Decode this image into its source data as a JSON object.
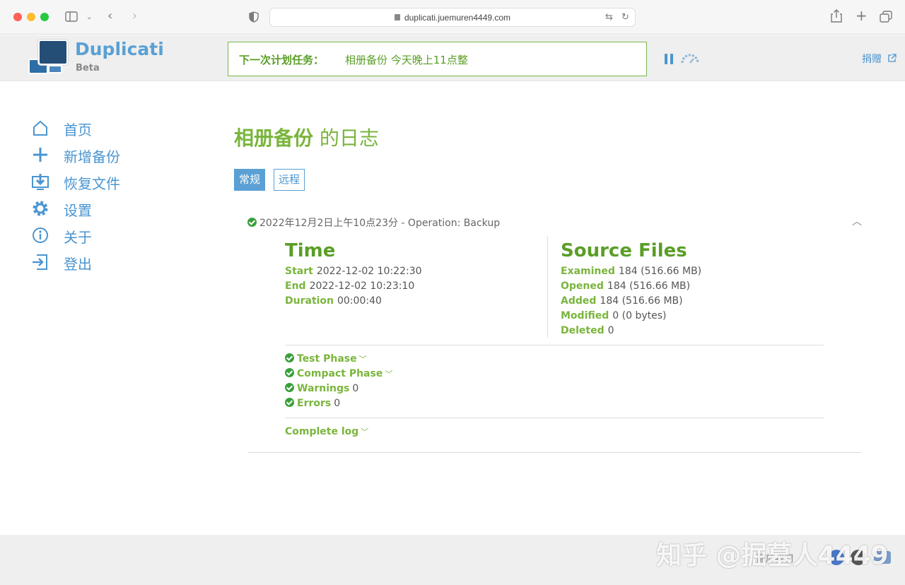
{
  "browser": {
    "url": "duplicati.juemuren4449.com"
  },
  "app": {
    "brand": "Duplicati",
    "beta": "Beta",
    "schedule_label": "下一次计划任务：",
    "schedule_value": "相册备份 今天晚上11点整",
    "donate": "捐赠"
  },
  "nav": {
    "items": [
      {
        "label": "首页",
        "icon": "home-icon"
      },
      {
        "label": "新增备份",
        "icon": "plus-icon"
      },
      {
        "label": "恢复文件",
        "icon": "restore-icon"
      },
      {
        "label": "设置",
        "icon": "gear-icon"
      },
      {
        "label": "关于",
        "icon": "info-icon"
      },
      {
        "label": "登出",
        "icon": "logout-icon"
      }
    ]
  },
  "page": {
    "title_bold": "相册备份",
    "title_rest": " 的日志",
    "tabs": [
      "常规",
      "远程"
    ]
  },
  "log": {
    "header": "2022年12月2日上午10点23分 - Operation: Backup",
    "time": {
      "title": "Time",
      "rows": [
        {
          "k": "Start",
          "v": "2022-12-02 10:22:30"
        },
        {
          "k": "End",
          "v": "2022-12-02 10:23:10"
        },
        {
          "k": "Duration",
          "v": "00:00:40"
        }
      ]
    },
    "source": {
      "title": "Source Files",
      "rows": [
        {
          "k": "Examined",
          "v": "184 (516.66 MB)"
        },
        {
          "k": "Opened",
          "v": "184 (516.66 MB)"
        },
        {
          "k": "Added",
          "v": "184 (516.66 MB)"
        },
        {
          "k": "Modified",
          "v": "0 (0 bytes)"
        },
        {
          "k": "Deleted",
          "v": "0"
        }
      ]
    },
    "phases": [
      {
        "label": "Test Phase",
        "value": ""
      },
      {
        "label": "Compact Phase",
        "value": ""
      },
      {
        "label": "Warnings",
        "value": "0"
      },
      {
        "label": "Errors",
        "value": "0"
      }
    ],
    "complete_log": "Complete log"
  },
  "footer": {
    "watermark": "知乎 @掘墓人4449",
    "link": "關於我們"
  },
  "colors": {
    "accent_blue": "#4a95d0",
    "accent_green": "#7ab53c",
    "success": "#3aa03a"
  }
}
